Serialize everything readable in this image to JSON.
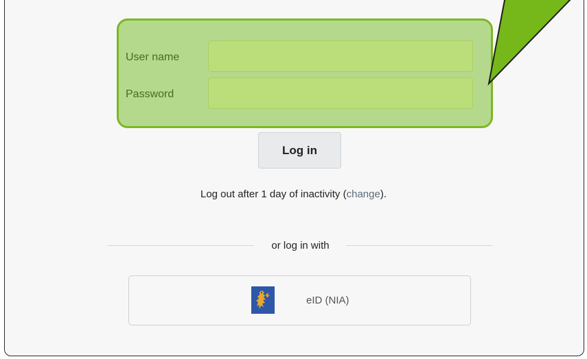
{
  "form": {
    "username_label": "User name",
    "password_label": "Password",
    "username_value": "",
    "password_value": "",
    "highlight_color": "#b5d98c"
  },
  "login_button": {
    "label": "Log in"
  },
  "session": {
    "prefix": "Log out after 1 day of inactivity (",
    "change_link": "change",
    "suffix": ")."
  },
  "alt_login": {
    "divider_text": "or log in with",
    "eid_label": "eID (NIA)",
    "eid_icon": "lion-crest-icon"
  },
  "colors": {
    "arrow": "#76b81a",
    "panel_border": "#2a2a2a"
  }
}
